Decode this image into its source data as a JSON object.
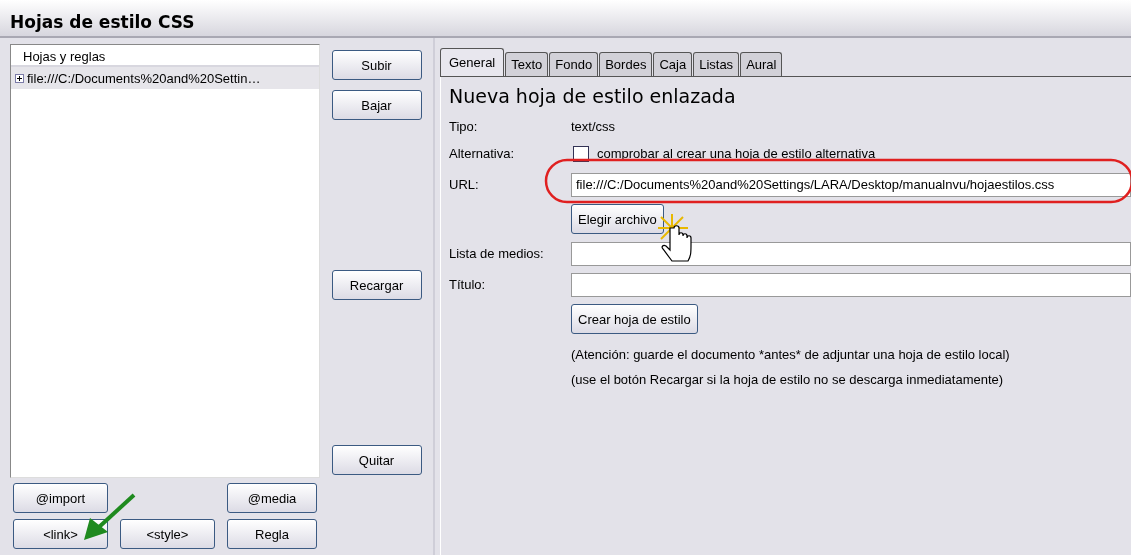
{
  "window": {
    "title": "Hojas de estilo CSS"
  },
  "tree": {
    "header": "Hojas y reglas",
    "items": [
      {
        "label": "file:///C:/Documents%20and%20Settin…",
        "expanded": false,
        "selected": true
      }
    ]
  },
  "side_buttons": [
    {
      "label": "Subir"
    },
    {
      "label": "Bajar"
    },
    {
      "label": "Recargar"
    },
    {
      "label": "Quitar"
    }
  ],
  "bottom_buttons": [
    {
      "label": "@import"
    },
    {
      "label": "@media"
    },
    {
      "label": "<link>"
    },
    {
      "label": "<style>"
    },
    {
      "label": "Regla"
    }
  ],
  "tabs": [
    {
      "label": "General",
      "selected": true
    },
    {
      "label": "Texto",
      "selected": false
    },
    {
      "label": "Fondo",
      "selected": false
    },
    {
      "label": "Bordes",
      "selected": false
    },
    {
      "label": "Caja",
      "selected": false
    },
    {
      "label": "Listas",
      "selected": false
    },
    {
      "label": "Aural",
      "selected": false
    }
  ],
  "form": {
    "heading": "Nueva hoja de estilo enlazada",
    "tipo": {
      "label": "Tipo:",
      "value": "text/css"
    },
    "alternativa": {
      "label": "Alternativa:",
      "checked": false,
      "text": "comprobar al crear una hoja de estilo alternativa"
    },
    "url": {
      "label": "URL:",
      "value": "file:///C:/Documents%20and%20Settings/LARA/Desktop/manualnvu/hojaestilos.css"
    },
    "choose_button": "Elegir archivo",
    "lista_medios": {
      "label": "Lista de medios:"
    },
    "titulo": {
      "label": "Título:"
    },
    "create_button": "Crear hoja de estilo",
    "notes": [
      "(Atención: guarde el documento *antes* de adjuntar una hoja de estilo local)",
      "(use el botón Recargar si la hoja de estilo no se descarga inmediatamente)"
    ]
  }
}
